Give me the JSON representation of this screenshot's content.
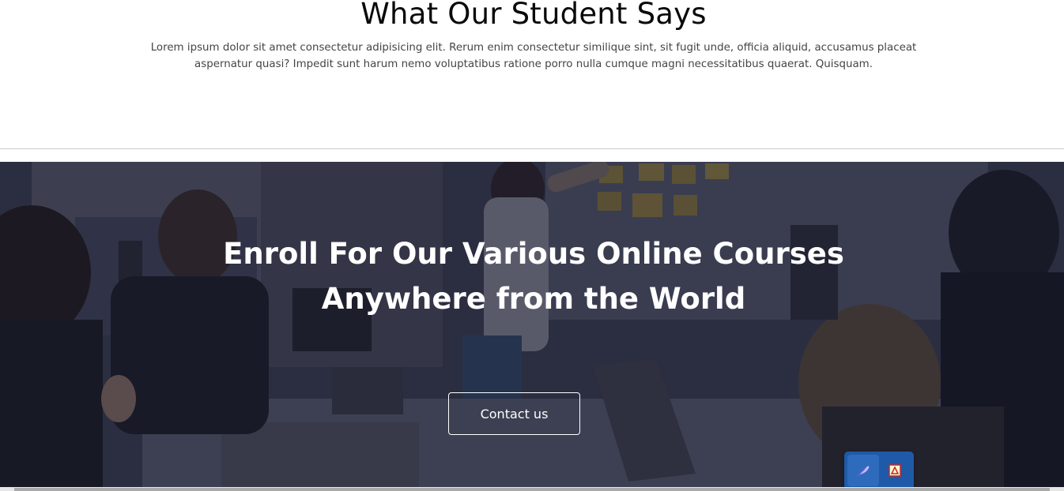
{
  "testimonials": {
    "title": "What Our Student Says",
    "description": "Lorem ipsum dolor sit amet consectetur adipisicing elit. Rerum enim consectetur similique sint, sit fugit unde, officia aliquid, accusamus placeat aspernatur quasi? Impedit sunt harum nemo voluptatibus ratione porro nulla cumque magni necessitatibus quaerat. Quisquam."
  },
  "hero": {
    "title_line1": "Enroll For Our Various Online Courses",
    "title_line2": "Anywhere from the World",
    "button_label": "Contact us",
    "background_image": "classroom-students-photo"
  },
  "floating_toolbar": {
    "icons": [
      "feather-icon",
      "pdf-icon"
    ],
    "color": "#1f5aa8"
  },
  "colors": {
    "overlay": "#16182d",
    "text_light": "#ffffff",
    "text_dark": "#0a0a0a"
  }
}
